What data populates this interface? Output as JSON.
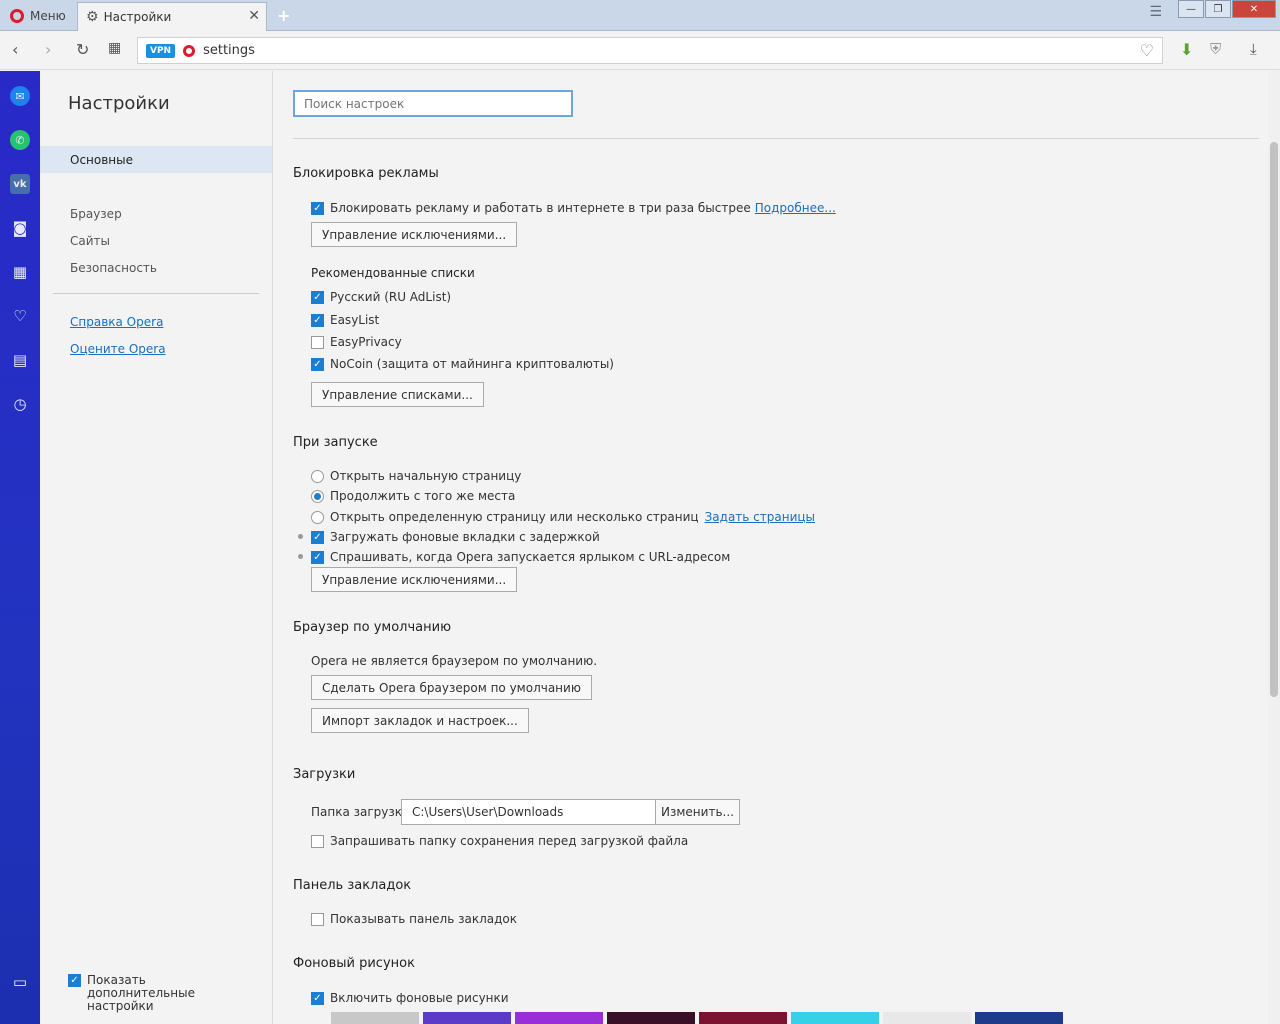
{
  "titlebar": {
    "menu_label": "Меню",
    "tab_title": "Настройки"
  },
  "addressbar": {
    "vpn_label": "VPN",
    "url": "settings"
  },
  "nav": {
    "title": "Настройки",
    "active_item": "Основные",
    "items": [
      "Браузер",
      "Сайты",
      "Безопасность"
    ],
    "links": [
      "Справка Opera",
      "Оцените Opera"
    ],
    "show_more_label": "Показать дополнительные настройки",
    "show_more_checked": true
  },
  "content": {
    "search_placeholder": "Поиск настроек",
    "adblock": {
      "title": "Блокировка рекламы",
      "block_label": "Блокировать рекламу и работать в интернете в три раза быстрее",
      "block_link": "Подробнее...",
      "block_checked": true,
      "exceptions_button": "Управление исключениями...",
      "recommended_title": "Рекомендованные списки",
      "lists": [
        {
          "label": "Русский (RU AdList)",
          "checked": true
        },
        {
          "label": "EasyList",
          "checked": true
        },
        {
          "label": "EasyPrivacy",
          "checked": false
        },
        {
          "label": "NoCoin (защита от майнинга криптовалюты)",
          "checked": true
        }
      ],
      "lists_button": "Управление списками..."
    },
    "startup": {
      "title": "При запуске",
      "opt_start": "Открыть начальную страницу",
      "opt_continue": "Продолжить с того же места",
      "opt_specific": "Открыть определенную страницу или несколько страниц",
      "opt_specific_link": "Задать страницы",
      "selected": "continue",
      "delay_tabs": "Загружать фоновые вкладки с задержкой",
      "ask_url": "Спрашивать, когда Opera запускается ярлыком с URL-адресом",
      "exceptions_button": "Управление исключениями..."
    },
    "default_browser": {
      "title": "Браузер по умолчанию",
      "status": "Opera не является браузером по умолчанию.",
      "make_default_button": "Сделать Opera браузером по умолчанию",
      "import_button": "Импорт закладок и настроек..."
    },
    "downloads": {
      "title": "Загрузки",
      "folder_label": "Папка загрузки:",
      "folder_value": "C:\\Users\\User\\Downloads",
      "change_button": "Изменить...",
      "ask_label": "Запрашивать папку сохранения перед загрузкой файла",
      "ask_checked": false
    },
    "bookmarks_bar": {
      "title": "Панель закладок",
      "show_label": "Показывать панель закладок",
      "show_checked": false
    },
    "wallpaper": {
      "title": "Фоновый рисунок",
      "enable_label": "Включить фоновые рисунки",
      "enable_checked": true,
      "thumb_colors": [
        "#c8c8c8",
        "#5a3cc8",
        "#9a2fd8",
        "#3a1028",
        "#7a1432",
        "#36d0e8",
        "#e8e8e8",
        "#1e3a8a"
      ]
    }
  },
  "colors": {
    "sidebar": "#2233c0",
    "accent": "#1a7fd4",
    "link": "#1a6fc0",
    "opera_red": "#e0192b"
  }
}
